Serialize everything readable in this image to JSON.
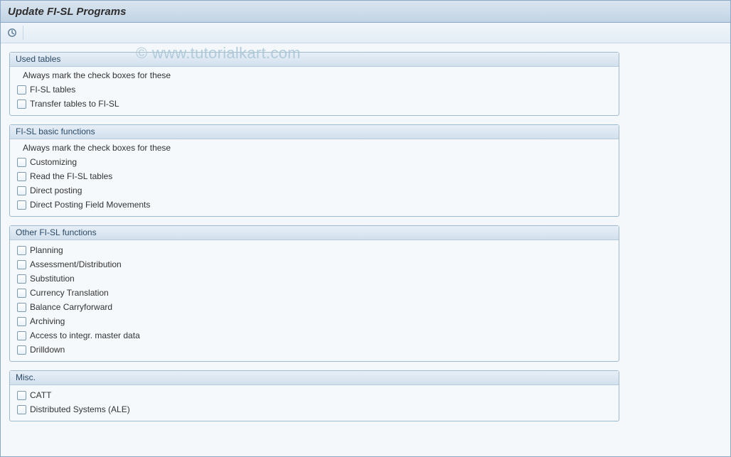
{
  "title": "Update FI-SL Programs",
  "watermark": "© www.tutorialkart.com",
  "groups": {
    "used_tables": {
      "title": "Used tables",
      "hint": "Always mark the check boxes for these",
      "items": {
        "fisl_tables": "FI-SL tables",
        "transfer_tables": "Transfer tables to FI-SL"
      }
    },
    "basic_functions": {
      "title": "FI-SL basic functions",
      "hint": "Always mark the check boxes for these",
      "items": {
        "customizing": "Customizing",
        "read_fisl": "Read the FI-SL tables",
        "direct_posting": "Direct posting",
        "direct_posting_fm": "Direct Posting Field Movements"
      }
    },
    "other_functions": {
      "title": "Other FI-SL functions",
      "items": {
        "planning": "Planning",
        "assess_dist": "Assessment/Distribution",
        "substitution": "Substitution",
        "currency": "Currency Translation",
        "balance_cf": "Balance Carryforward",
        "archiving": "Archiving",
        "access_master": "Access to integr. master data",
        "drilldown": "Drilldown"
      }
    },
    "misc": {
      "title": "Misc.",
      "items": {
        "catt": "CATT",
        "dist_systems": "Distributed Systems (ALE)"
      }
    }
  }
}
